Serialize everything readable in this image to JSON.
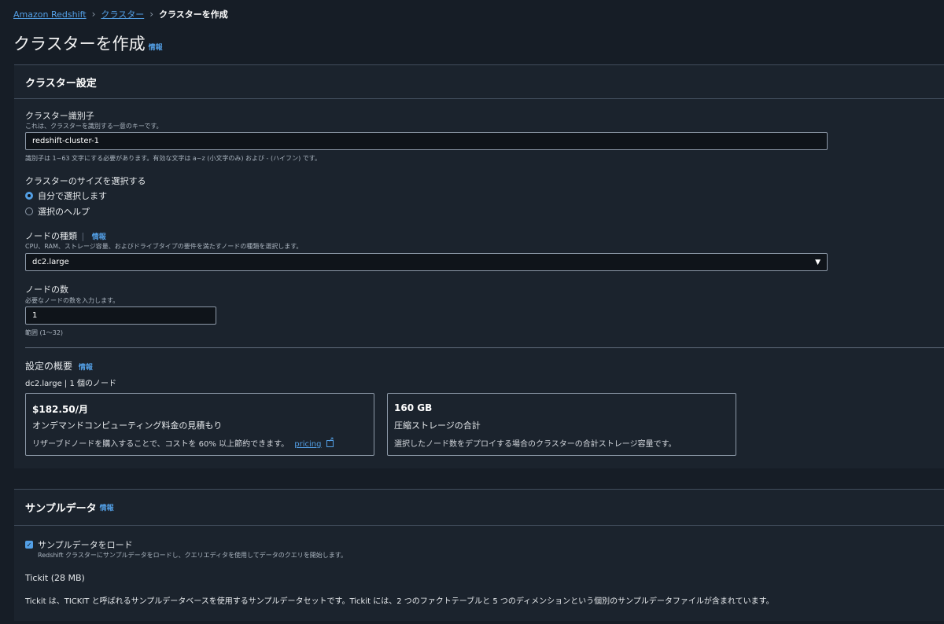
{
  "breadcrumb": {
    "home": "Amazon Redshift",
    "clusters": "クラスター",
    "current": "クラスターを作成"
  },
  "page": {
    "title": "クラスターを作成",
    "info": "情報"
  },
  "cluster_settings": {
    "title": "クラスター設定",
    "identifier_label": "クラスター識別子",
    "identifier_desc": "これは、クラスターを識別する一意のキーです。",
    "identifier_value": "redshift-cluster-1",
    "identifier_constraint": "識別子は 1~63 文字にする必要があります。有効な文字は a~z (小文字のみ) および - (ハイフン) です。",
    "size_label": "クラスターのサイズを選択する",
    "size_options": [
      "自分で選択します",
      "選択のヘルプ"
    ],
    "node_type_label": "ノードの種類",
    "node_type_info": "情報",
    "node_type_desc": "CPU、RAM、ストレージ容量、およびドライブタイプの要件を満たすノードの種類を選択します。",
    "node_type_value": "dc2.large",
    "node_count_label": "ノードの数",
    "node_count_desc": "必要なノードの数を入力します。",
    "node_count_value": "1",
    "node_count_range": "範囲 (1～32)",
    "summary_title": "設定の概要",
    "summary_info": "情報",
    "summary_line": "dc2.large | 1 個のノード",
    "cost_card": {
      "price": "$182.50/月",
      "label": "オンデマンドコンピューティング料金の見積もり",
      "note": "リザーブドノードを購入することで、コストを 60% 以上節約できます。",
      "link": "pricing"
    },
    "storage_card": {
      "size": "160 GB",
      "label": "圧縮ストレージの合計",
      "note": "選択したノード数をデプロイする場合のクラスターの合計ストレージ容量です。"
    }
  },
  "sample_data": {
    "title": "サンプルデータ",
    "info": "情報",
    "checkbox_label": "サンプルデータをロード",
    "checkbox_desc": "Redshift クラスターにサンプルデータをロードし、クエリエディタを使用してデータのクエリを開始します。",
    "dataset_title": "Tickit (28 MB)",
    "dataset_desc": "Tickit は、TICKIT と呼ばれるサンプルデータベースを使用するサンプルデータセットです。Tickit には、2 つのファクトテーブルと 5 つのディメンションという個別のサンプルデータファイルが含まれています。"
  },
  "colors": {
    "background": "#161d26",
    "panel": "#1b232d",
    "accent": "#539fe5",
    "border": "#414d5c"
  }
}
